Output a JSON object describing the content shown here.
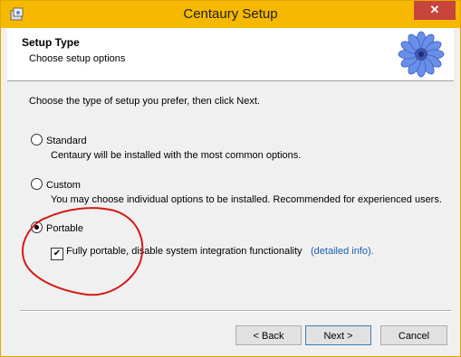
{
  "window": {
    "title": "Centaury Setup",
    "close_glyph": "✕",
    "titlebar_color": "#f6b800",
    "close_color": "#c7453b"
  },
  "header": {
    "title": "Setup Type",
    "subtitle": "Choose setup options",
    "logo_icon": "cornflower-logo-icon"
  },
  "body": {
    "instructions": "Choose the type of setup you prefer, then click Next.",
    "options": [
      {
        "label": "Standard",
        "description": "Centaury will be installed with the most common options.",
        "selected": false
      },
      {
        "label": "Custom",
        "description": "You may choose individual options to be installed. Recommended for experienced users.",
        "selected": false
      },
      {
        "label": "Portable",
        "description": "",
        "selected": true
      }
    ],
    "portable_checkbox": {
      "label": "Fully portable, disable system integration functionality",
      "checked": true,
      "check_glyph": "✔"
    },
    "link_text": "(detailed info).",
    "link_color": "#1a5fb4"
  },
  "buttons": {
    "back": "< Back",
    "next": "Next >",
    "cancel": "Cancel"
  },
  "annotation": {
    "color": "#d41a1a",
    "shape": "hand-drawn-circle"
  }
}
